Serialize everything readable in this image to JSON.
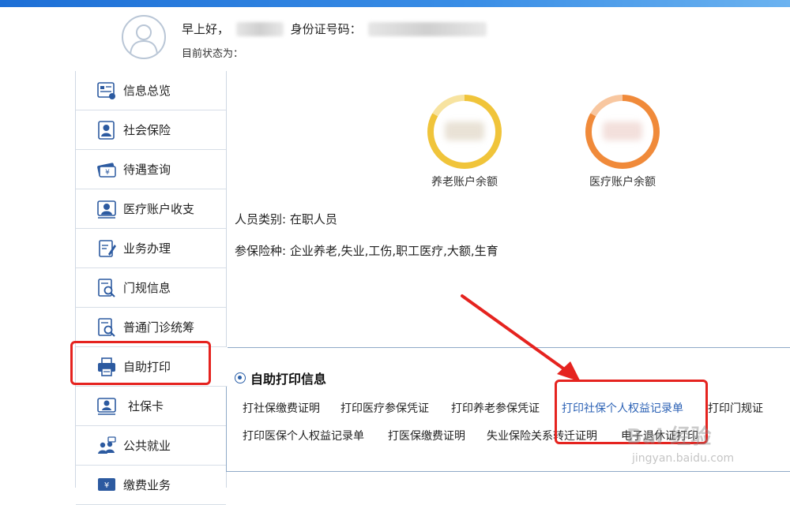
{
  "header": {
    "greeting": "早上好，",
    "id_label": "身份证号码：",
    "status_label": "目前状态为："
  },
  "sidebar": {
    "items": [
      {
        "label": "信息总览",
        "icon": "overview-icon"
      },
      {
        "label": "社会保险",
        "icon": "id-card-icon"
      },
      {
        "label": "待遇查询",
        "icon": "money-icon"
      },
      {
        "label": "医疗账户收支",
        "icon": "medical-account-icon"
      },
      {
        "label": "业务办理",
        "icon": "edit-doc-icon"
      },
      {
        "label": "门规信息",
        "icon": "search-doc-icon"
      },
      {
        "label": "普通门诊统筹",
        "icon": "search-doc-icon"
      },
      {
        "label": "自助打印",
        "icon": "printer-icon"
      },
      {
        "label": "社保卡",
        "icon": "card-user-icon"
      },
      {
        "label": "公共就业",
        "icon": "people-icon"
      },
      {
        "label": "缴费业务",
        "icon": "payment-icon"
      }
    ]
  },
  "balances": {
    "pension_label": "养老账户余额",
    "medical_label": "医疗账户余额",
    "pension_color": "#f0c43a",
    "medical_color": "#f08a3a"
  },
  "person": {
    "category": "人员类别: 在职人员",
    "insurance_types": "参保险种: 企业养老,失业,工伤,职工医疗,大额,生育"
  },
  "print_panel": {
    "title": "自助打印信息",
    "links_row1": [
      "打社保缴费证明",
      "打印医疗参保凭证",
      "打印养老参保凭证",
      "打印社保个人权益记录单",
      "打印门规证"
    ],
    "links_row2": [
      "打印医保个人权益记录单",
      "打医保缴费证明",
      "失业保险关系转迁证明",
      "电子退休证打印"
    ]
  },
  "watermark": {
    "brand": "Bai 经验",
    "url": "jingyan.baidu.com"
  },
  "colors": {
    "accent_blue": "#2c62b5",
    "highlight_red": "#e5231f",
    "topbar": "#1d6fd6"
  }
}
